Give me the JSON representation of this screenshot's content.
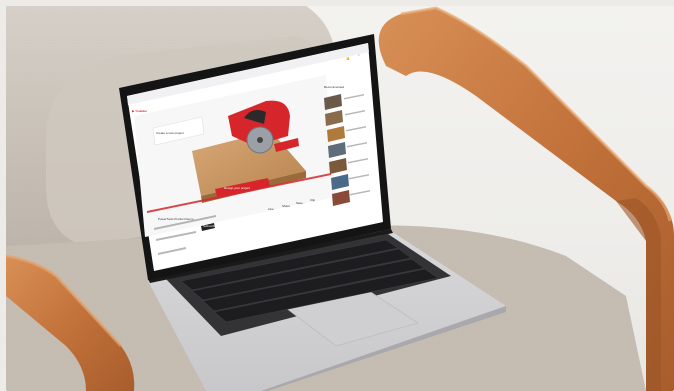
{
  "scene": {
    "description_colors": {
      "wall": "#efeeeb",
      "chair_wood": "#c77a3f",
      "chair_fabric": "#cdc6bd",
      "laptop_body": "#d4d4d6",
      "screen_bezel": "#151515",
      "accent_red": "#d6262c"
    }
  },
  "screen": {
    "site_logo_text": "▶ Youtube",
    "video_overlay_heading": "Create a new project",
    "video_cta_text": "Design your project",
    "video_title": "PowerTools Product Demo",
    "channel_button": "Subscribe",
    "sidebar_heading": "Recommended",
    "action_labels": [
      "Like",
      "Share",
      "Save",
      "Clip"
    ],
    "icons": [
      "play-icon",
      "search-icon",
      "bell-icon"
    ]
  }
}
